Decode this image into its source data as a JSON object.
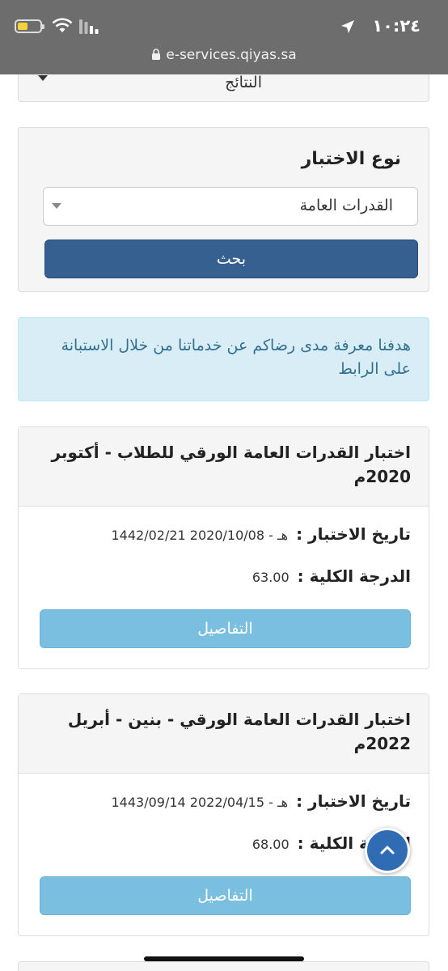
{
  "status_bar": {
    "time": "١٠:٢٤"
  },
  "browser": {
    "url": "e-services.qiyas.sa"
  },
  "top_select": {
    "value": "النتائج"
  },
  "filter": {
    "label": "نوع الاختبار",
    "selected": "القدرات العامة",
    "search_label": "بحث"
  },
  "alert": {
    "text": "هدفنا معرفة مدى رضاكم عن خدماتنا من خلال الاستبانة على الرابط"
  },
  "results": [
    {
      "title": "اختبار القدرات العامة الورقي للطلاب - أكتوبر 2020م",
      "date_label": "تاريخ الاختبار :",
      "date_value": "1442/02/21 هـ - 2020/10/08",
      "score_label": "الدرجة الكلية :",
      "score_value": "63.00",
      "details_label": "التفاصيل"
    },
    {
      "title": "اختبار القدرات العامة الورقي - بنين - أبريل 2022م",
      "date_label": "تاريخ الاختبار :",
      "date_value": "1443/09/14 هـ - 2022/04/15",
      "score_label": "الدرجة الكلية :",
      "score_value": "68.00",
      "details_label": "التفاصيل"
    }
  ],
  "icons": {
    "scroll_top": "chevron-up-icon",
    "lock": "lock-icon",
    "location": "location-arrow-icon"
  },
  "colors": {
    "primary_button": "#36608f",
    "details_button": "#7bbfe0",
    "alert_bg": "#d9edf7",
    "alert_text": "#31708f",
    "scroll_button": "#2f6cb3"
  }
}
